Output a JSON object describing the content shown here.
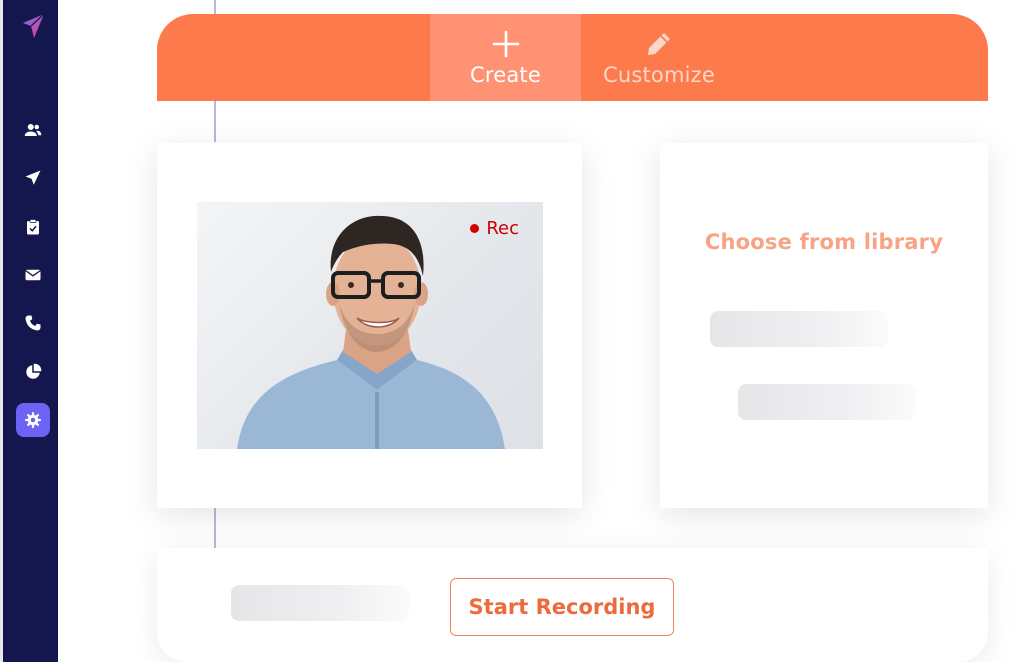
{
  "sidebar": {
    "items": [
      {
        "icon": "users-icon"
      },
      {
        "icon": "send-icon"
      },
      {
        "icon": "clipboard-icon"
      },
      {
        "icon": "mail-icon"
      },
      {
        "icon": "phone-icon"
      },
      {
        "icon": "pie-chart-icon"
      },
      {
        "icon": "gear-icon",
        "active": true
      }
    ],
    "active_color": "#6c63f5",
    "background": "#14174d"
  },
  "tabs": [
    {
      "label": "Create",
      "icon": "plus-icon",
      "active": true
    },
    {
      "label": "Customize",
      "icon": "pencil-icon",
      "active": false
    }
  ],
  "recorder": {
    "status_label": "Rec",
    "status_color": "#cc0000"
  },
  "library": {
    "title": "Choose from library"
  },
  "actions": {
    "start_label": "Start Recording"
  },
  "colors": {
    "accent": "#fd7a4c",
    "accent_light": "#fe9272"
  }
}
